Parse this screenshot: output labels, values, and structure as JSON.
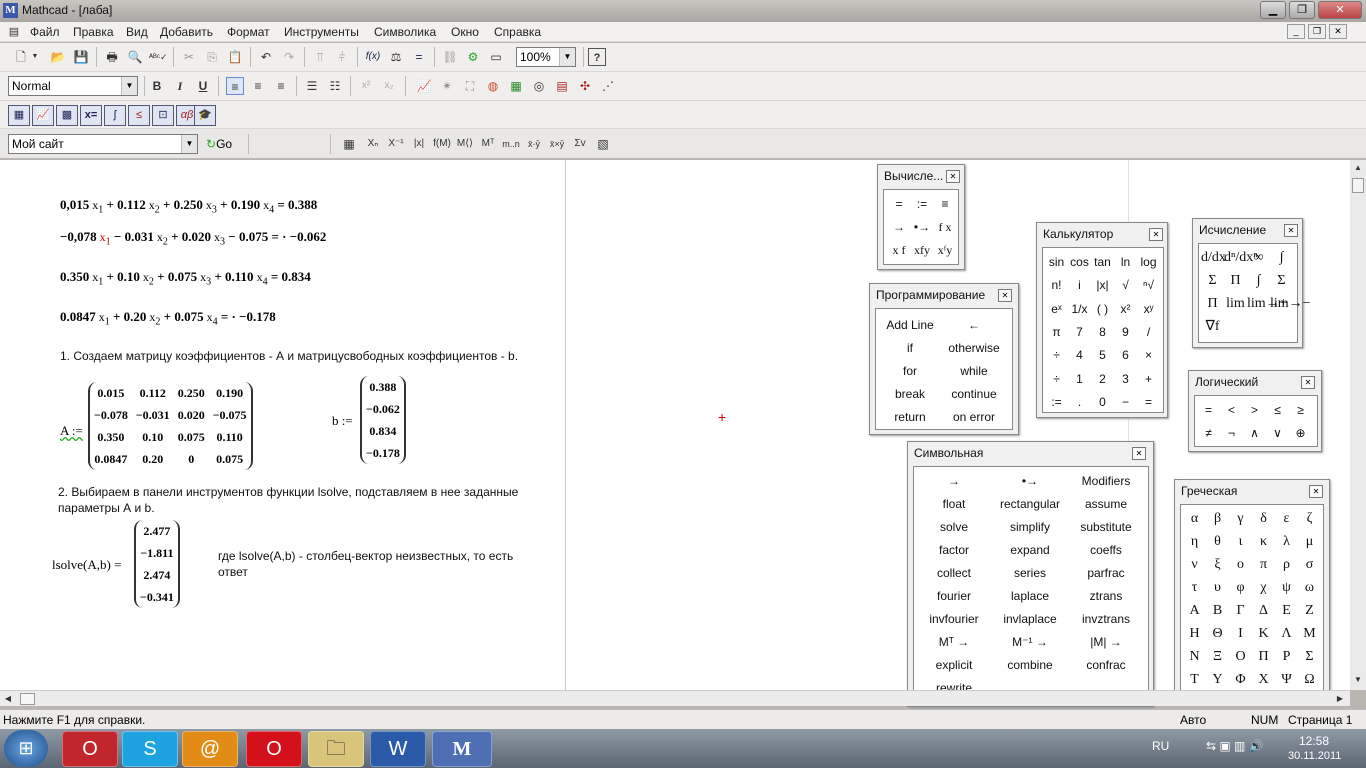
{
  "window": {
    "title": "Mathcad - [лаба]",
    "app_icon": "M"
  },
  "menu": [
    "Файл",
    "Правка",
    "Вид",
    "Добавить",
    "Формат",
    "Инструменты",
    "Символика",
    "Окно",
    "Справка"
  ],
  "toolbar": {
    "zoom": "100%",
    "style": "Normal",
    "bold": "B",
    "italic": "I",
    "underline": "U",
    "address": "Мой сайт",
    "go": "Go"
  },
  "document": {
    "eq1": {
      "a": "0,015",
      "b": "0.112",
      "c": "0.250",
      "d": "0.190",
      "rhs": "0.388"
    },
    "eq2": {
      "a": "−0,078",
      "b": "0.031",
      "c": "0.020",
      "d": "0.075",
      "rhs": "−0.062"
    },
    "eq3": {
      "a": "0.350",
      "b": "0.10",
      "c": "0.075",
      "d": "0.110",
      "rhs": "0.834"
    },
    "eq4": {
      "a": "0.0847",
      "b": "0.20",
      "c": "0.075",
      "rhs": "−0.178"
    },
    "step1": "1. Создаем матрицу коэффициентов - А и матрицусвободных коэффициентов - b.",
    "A_label": "A :=",
    "A": [
      [
        "0.015",
        "0.112",
        "0.250",
        "0.190"
      ],
      [
        "−0.078",
        "−0.031",
        "0.020",
        "−0.075"
      ],
      [
        "0.350",
        "0.10",
        "0.075",
        "0.110"
      ],
      [
        "0.0847",
        "0.20",
        "0",
        "0.075"
      ]
    ],
    "b_label": "b :=",
    "b": [
      "0.388",
      "−0.062",
      "0.834",
      "−0.178"
    ],
    "step2a": "2. Выбираем в панели инструментов функции lsolve, подставляем в нее заданные",
    "step2b": "параметры А и b.",
    "lsolve_label": "lsolve(A,b) =",
    "result": [
      "2.477",
      "−1.811",
      "2.474",
      "−0.341"
    ],
    "note_a": "где lsolve(A,b) - столбец-вектор неизвестных, то есть",
    "note_b": "ответ"
  },
  "palettes": {
    "evaluation": {
      "title": "Вычисле...",
      "items": [
        "=",
        ":=",
        "≡",
        "→",
        "•→",
        "f x",
        "x f",
        "xfy",
        "xᶠy"
      ]
    },
    "calculator": {
      "title": "Калькулятор",
      "items": [
        "sin",
        "cos",
        "tan",
        "ln",
        "log",
        "n!",
        "i",
        "|x|",
        "√",
        "ⁿ√",
        "eˣ",
        "1/x",
        "( )",
        "x²",
        "xʸ",
        "π",
        "7",
        "8",
        "9",
        "/",
        "÷",
        "4",
        "5",
        "6",
        "×",
        "÷",
        "1",
        "2",
        "3",
        "+",
        ":=",
        ".",
        "0",
        "−",
        "="
      ]
    },
    "calculus": {
      "title": "Исчисление",
      "items": [
        "d/dx",
        "dⁿ/dxⁿ",
        "∞",
        "∫",
        "Σ",
        "Π",
        "∫",
        "Σ",
        "Π",
        "lim",
        "lim→+",
        "lim→−",
        "∇f"
      ]
    },
    "programming": {
      "title": "Программирование",
      "items": [
        "Add Line",
        "←",
        "if",
        "otherwise",
        "for",
        "while",
        "break",
        "continue",
        "return",
        "on error"
      ]
    },
    "boolean": {
      "title": "Логический",
      "items": [
        "=",
        "<",
        ">",
        "≤",
        "≥",
        "≠",
        "¬",
        "∧",
        "∨",
        "⊕"
      ]
    },
    "symbolic": {
      "title": "Символьная",
      "items": [
        "→",
        "•→",
        "Modifiers",
        "float",
        "rectangular",
        "assume",
        "solve",
        "simplify",
        "substitute",
        "factor",
        "expand",
        "coeffs",
        "collect",
        "series",
        "parfrac",
        "fourier",
        "laplace",
        "ztrans",
        "invfourier",
        "invlaplace",
        "invztrans",
        "Mᵀ →",
        "M⁻¹ →",
        "|M| →",
        "explicit",
        "combine",
        "confrac",
        "rewrite"
      ]
    },
    "greek": {
      "title": "Греческая",
      "items": [
        "α",
        "β",
        "γ",
        "δ",
        "ε",
        "ζ",
        "η",
        "θ",
        "ι",
        "κ",
        "λ",
        "μ",
        "ν",
        "ξ",
        "ο",
        "π",
        "ρ",
        "σ",
        "τ",
        "υ",
        "φ",
        "χ",
        "ψ",
        "ω",
        "Α",
        "Β",
        "Γ",
        "Δ",
        "Ε",
        "Ζ",
        "Η",
        "Θ",
        "Ι",
        "Κ",
        "Λ",
        "Μ",
        "Ν",
        "Ξ",
        "Ο",
        "Π",
        "Ρ",
        "Σ",
        "Τ",
        "Υ",
        "Φ",
        "Χ",
        "Ψ",
        "Ω"
      ]
    }
  },
  "status": {
    "help": "Нажмите F1 для справки.",
    "auto": "Авто",
    "num": "NUM",
    "page": "Страница 1"
  },
  "taskbar": {
    "lang": "RU",
    "time": "12:58",
    "date": "30.11.2011"
  }
}
